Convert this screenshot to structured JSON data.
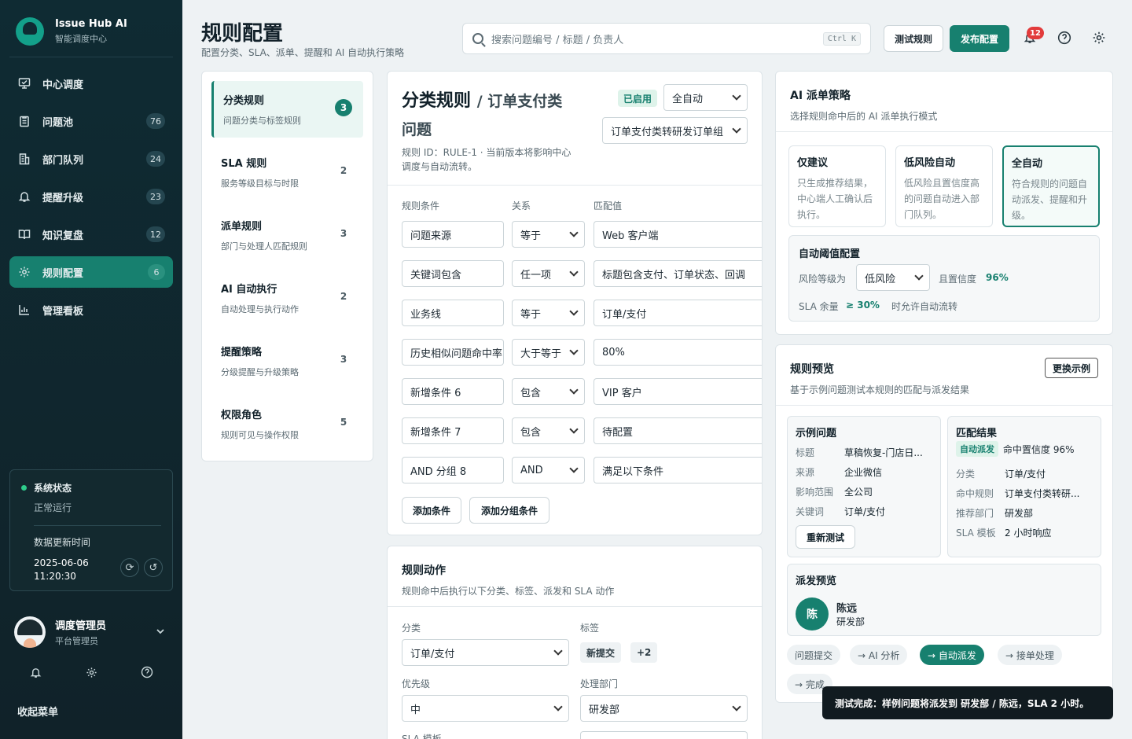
{
  "brand": {
    "name": "Issue Hub AI",
    "sub": "智能调度中心"
  },
  "nav": [
    {
      "label": "中心调度",
      "count": "",
      "icon": "monitor-icon"
    },
    {
      "label": "问题池",
      "count": "76",
      "icon": "clipboard-icon"
    },
    {
      "label": "部门队列",
      "count": "24",
      "icon": "building-icon"
    },
    {
      "label": "提醒升级",
      "count": "23",
      "icon": "bell-icon"
    },
    {
      "label": "知识复盘",
      "count": "12",
      "icon": "book-icon"
    },
    {
      "label": "规则配置",
      "count": "6",
      "icon": "gear-icon"
    },
    {
      "label": "管理看板",
      "count": "",
      "icon": "bar-chart-icon"
    }
  ],
  "status": {
    "title": "系统状态",
    "value": "正常运行",
    "update_label": "数据更新时间",
    "date": "2025-06-06",
    "time": "11:20:30"
  },
  "user": {
    "name": "调度管理员",
    "role": "平台管理员"
  },
  "collapse_label": "收起菜单",
  "header": {
    "title": "规则配置",
    "subtitle": "配置分类、SLA、派单、提醒和 AI 自动执行策略",
    "search_placeholder": "搜索问题编号 / 标题 / 负责人",
    "search_kbd": "Ctrl K",
    "test_btn": "测试规则",
    "publish_btn": "发布配置",
    "notif_count": "12"
  },
  "categories": [
    {
      "name": "分类规则",
      "desc": "问题分类与标签规则",
      "count": "3"
    },
    {
      "name": "SLA 规则",
      "desc": "服务等级目标与时限",
      "count": "2"
    },
    {
      "name": "派单规则",
      "desc": "部门与处理人匹配规则",
      "count": "3"
    },
    {
      "name": "AI 自动执行",
      "desc": "自动处理与执行动作",
      "count": "2"
    },
    {
      "name": "提醒策略",
      "desc": "分级提醒与升级策略",
      "count": "3"
    },
    {
      "name": "权限角色",
      "desc": "规则可见与操作权限",
      "count": "5"
    }
  ],
  "rule": {
    "title": "分类规则",
    "title_sub": "/ 订单支付类问题",
    "meta": "规则 ID：RULE-1 · 当前版本将影响中心调度与自动流转。",
    "status_tag": "已启用",
    "mode_select": "全自动",
    "group_select": "订单支付类转研发订单组",
    "col_condition": "规则条件",
    "col_relation": "关系",
    "col_value": "匹配值",
    "conditions": [
      {
        "cond": "问题来源",
        "rel": "等于",
        "val": "Web 客户端"
      },
      {
        "cond": "关键词包含",
        "rel": "任一项",
        "val": "标题包含支付、订单状态、回调"
      },
      {
        "cond": "业务线",
        "rel": "等于",
        "val": "订单/支付"
      },
      {
        "cond": "历史相似问题命中率",
        "rel": "大于等于",
        "val": "80%"
      },
      {
        "cond": "新增条件 6",
        "rel": "包含",
        "val": "VIP 客户"
      },
      {
        "cond": "新增条件 7",
        "rel": "包含",
        "val": "待配置"
      },
      {
        "cond": "AND 分组 8",
        "rel": "AND",
        "val": "满足以下条件"
      }
    ],
    "add_condition": "添加条件",
    "add_group": "添加分组条件"
  },
  "actions": {
    "title": "规则动作",
    "subtitle": "规则命中后执行以下分类、标签、派发和 SLA 动作",
    "category_label": "分类",
    "category_value": "订单/支付",
    "tags_label": "标签",
    "tag1": "新提交",
    "tag_more": "+2",
    "priority_label": "优先级",
    "priority_value": "中",
    "dept_label": "处理部门",
    "dept_value": "研发部",
    "sla_label": "SLA 模板"
  },
  "ai": {
    "title": "AI 派单策略",
    "subtitle": "选择规则命中后的 AI 派单执行模式",
    "modes": [
      {
        "name": "仅建议",
        "desc": "只生成推荐结果，中心端人工确认后执行。"
      },
      {
        "name": "低风险自动",
        "desc": "低风险且置信度高的问题自动进入部门队列。"
      },
      {
        "name": "全自动",
        "desc": "符合规则的问题自动派发、提醒和升级。"
      }
    ],
    "threshold_title": "自动阈值配置",
    "risk_label": "风险等级为",
    "risk_value": "低风险",
    "conf_label": "且置信度",
    "conf_value": "96%",
    "sla_label": "SLA 余量",
    "sla_value": "≥ 30%",
    "sla_suffix": "时允许自动流转"
  },
  "preview": {
    "title": "规则预览",
    "subtitle": "基于示例问题测试本规则的匹配与派发结果",
    "change_btn": "更换示例",
    "sample_title": "示例问题",
    "sample": [
      {
        "k": "标题",
        "v": "草稿恢复-门店日..."
      },
      {
        "k": "来源",
        "v": "企业微信"
      },
      {
        "k": "影响范围",
        "v": "全公司"
      },
      {
        "k": "关键词",
        "v": "订单/支付"
      }
    ],
    "retest_btn": "重新测试",
    "result_title": "匹配结果",
    "result_tag": "自动派发",
    "result_conf": "命中置信度 96%",
    "result": [
      {
        "k": "分类",
        "v": "订单/支付"
      },
      {
        "k": "命中规则",
        "v": "订单支付类转研..."
      },
      {
        "k": "推荐部门",
        "v": "研发部"
      },
      {
        "k": "SLA 模板",
        "v": "2 小时响应"
      }
    ],
    "dispatch_title": "派发预览",
    "assignee_initial": "陈",
    "assignee_name": "陈远",
    "assignee_dept": "研发部",
    "flow": [
      "问题提交",
      "→ AI 分析",
      "→ 自动派发",
      "→ 接单处理",
      "→ 完成"
    ]
  },
  "toast": "测试完成：样例问题将派发到 研发部 / 陈远，SLA 2 小时。",
  "colors": {
    "accent": "#17806f",
    "sidebar": "#0f2b33",
    "danger": "#e23b3b"
  }
}
